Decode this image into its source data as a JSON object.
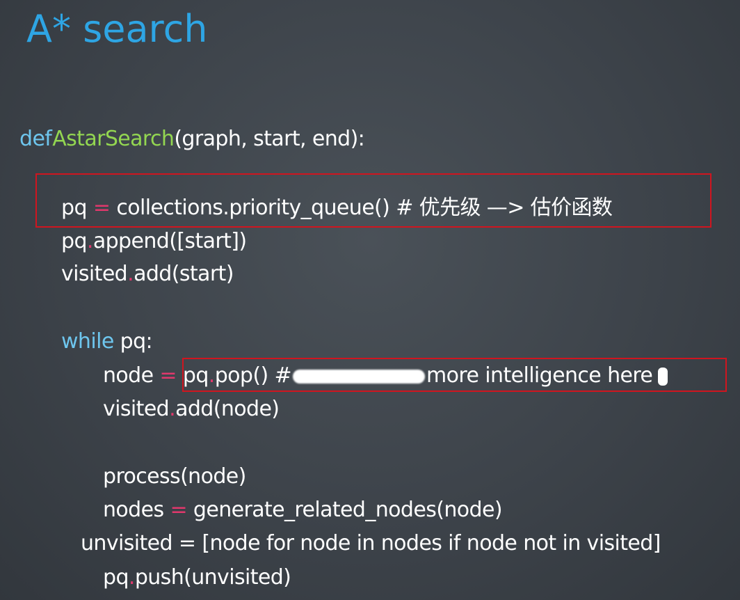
{
  "title": "A* search",
  "code": {
    "def_kw": "def",
    "func_name": "AstarSearch",
    "params": "(graph, start, end):",
    "l_pq_var": "pq",
    "l_pq_eq": "=",
    "l_pq_rest": "collections.priority_queue() # 优先级 —> 估价函数",
    "l_append_a": "pq",
    "l_append_dot": ".",
    "l_append_b": "append([start])",
    "l_visited_a": "visited",
    "l_visited_dot": ".",
    "l_visited_b": "add(start)",
    "while_kw": "while",
    "while_rest": " pq:",
    "node_var": "node",
    "node_eq": "=",
    "node_pq": "pq",
    "node_dot": ".",
    "node_rest": "pop() #",
    "node_comment": "more intelligence here",
    "vnode_a": "visited",
    "vnode_dot": ".",
    "vnode_b": "add(node)",
    "process": "process(node)",
    "nodes_var": "nodes",
    "nodes_eq": "=",
    "nodes_rest": "generate_related_nodes(node)",
    "unvisited": "unvisited = [node for node in nodes if node not in visited]",
    "push_a": "pq",
    "push_dot": ".",
    "push_b": "push(unvisited)"
  },
  "colors": {
    "title": "#2ea5e4",
    "keyword": "#6ec6ee",
    "function": "#93d651",
    "operator": "#e0386c",
    "highlight_box": "#d0151f"
  }
}
